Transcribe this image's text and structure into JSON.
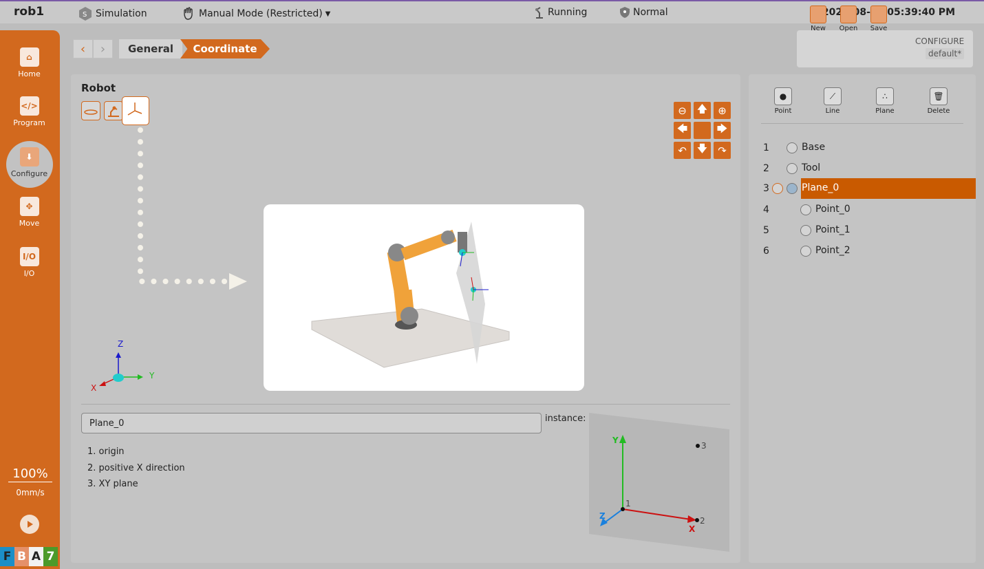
{
  "topbar": {
    "robot_name": "rob1",
    "mode_sim": "Simulation",
    "mode_manual": "Manual Mode (Restricted)",
    "running": "Running",
    "safety": "Normal",
    "datetime": "2026-08-03 05:39:40 PM"
  },
  "sidebar": {
    "items": [
      {
        "label": "Home"
      },
      {
        "label": "Program"
      },
      {
        "label": "Configure"
      },
      {
        "label": "Move"
      },
      {
        "label": "I/O"
      }
    ],
    "io_icon_text": "I/O",
    "speed_pct": "100%",
    "speed_val": "0mm/s",
    "status": [
      "F",
      "B",
      "A",
      "7"
    ]
  },
  "breadcrumb": {
    "general": "General",
    "coordinate": "Coordinate"
  },
  "toolbar": {
    "new": "New",
    "open": "Open",
    "save": "Save",
    "configure_label": "CONFIGURE",
    "configure_value": "default*"
  },
  "main": {
    "title": "Robot",
    "axes": {
      "x": "X",
      "y": "Y",
      "z": "Z"
    },
    "name_value": "Plane_0",
    "steps": [
      "1. origin",
      "2. positive X direction",
      "3. XY plane"
    ],
    "instance_label": "instance:",
    "instance_points": {
      "p1": "1",
      "p2": "2",
      "p3": "3"
    },
    "instance_axes": {
      "x": "X",
      "y": "Y",
      "z": "Z"
    }
  },
  "right_panel": {
    "buttons": {
      "point": "Point",
      "line": "Line",
      "plane": "Plane",
      "delete": "Delete"
    },
    "tree": [
      {
        "num": "1",
        "label": "Base"
      },
      {
        "num": "2",
        "label": "Tool"
      },
      {
        "num": "3",
        "label": "Plane_0"
      },
      {
        "num": "4",
        "label": "Point_0"
      },
      {
        "num": "5",
        "label": "Point_1"
      },
      {
        "num": "6",
        "label": "Point_2"
      }
    ]
  },
  "colors": {
    "accent": "#d2691e",
    "selected_row": "#c95a00",
    "status_f": "#1c8fc7",
    "status_b": "#e5906a",
    "status_a": "#f2f2f2",
    "status_7": "#4c9a2a"
  }
}
